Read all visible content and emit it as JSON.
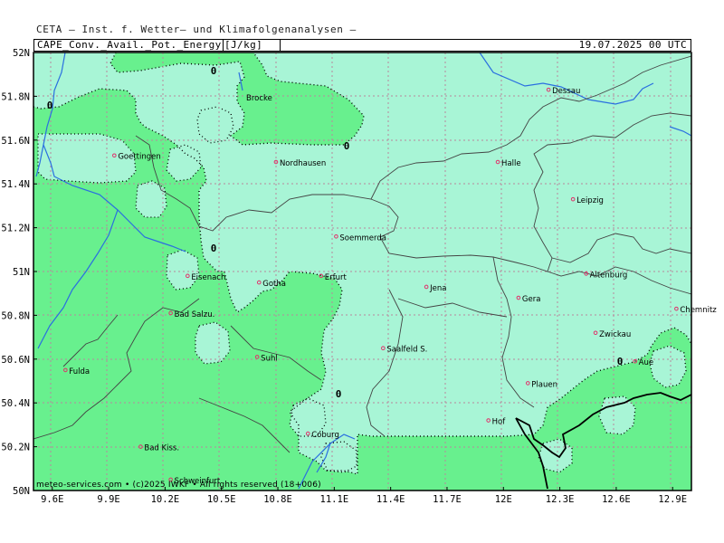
{
  "header": {
    "source": "CETA — Inst. f. Wetter— und Klimafolgenanalysen —",
    "product": "CAPE_Conv._Avail._Pot._Energy",
    "unit": "[J/kg]",
    "valid": "19.07.2025 00 UTC"
  },
  "footer": {
    "copyright": "meteo-services.com • (c)2025 IWKF • All rights reserved (18+006)"
  },
  "axes": {
    "lat_labels": [
      "52N",
      "51.8N",
      "51.6N",
      "51.4N",
      "51.2N",
      "51N",
      "50.8N",
      "50.6N",
      "50.4N",
      "50.2N",
      "50N"
    ],
    "lon_labels": [
      "9.6E",
      "9.9E",
      "10.2E",
      "10.5E",
      "10.8E",
      "11.1E",
      "11.4E",
      "11.7E",
      "12E",
      "12.3E",
      "12.6E",
      "12.9E"
    ],
    "lat_values": [
      52,
      51.8,
      51.6,
      51.4,
      51.2,
      51.0,
      50.8,
      50.6,
      50.4,
      50.2,
      50.0
    ],
    "lon_values": [
      9.6,
      9.9,
      10.2,
      10.5,
      10.8,
      11.1,
      11.4,
      11.7,
      12.0,
      12.3,
      12.6,
      12.9
    ]
  },
  "colors": {
    "cape_zero": "#a8f5d6",
    "cape_low": "#68f08e",
    "contour_label_color": "#000000",
    "city_marker": "#e0306a",
    "river": "#2a6fe0",
    "border": "#444444"
  },
  "contour_labels": [
    "0",
    "0",
    "0",
    "0",
    "0",
    "0"
  ],
  "cities": [
    {
      "name": "Goettingen",
      "lon": 9.93,
      "lat": 51.53
    },
    {
      "name": "Nordhausen",
      "lon": 10.79,
      "lat": 51.5
    },
    {
      "name": "Halle",
      "lon": 11.97,
      "lat": 51.5
    },
    {
      "name": "Dessau",
      "lon": 12.24,
      "lat": 51.83
    },
    {
      "name": "Leipzig",
      "lon": 12.37,
      "lat": 51.33
    },
    {
      "name": "Soemmerda",
      "lon": 11.11,
      "lat": 51.16
    },
    {
      "name": "Eisenach",
      "lon": 10.32,
      "lat": 50.98
    },
    {
      "name": "Gotha",
      "lon": 10.7,
      "lat": 50.95
    },
    {
      "name": "Erfurt",
      "lon": 11.03,
      "lat": 50.98
    },
    {
      "name": "Jena",
      "lon": 11.59,
      "lat": 50.93
    },
    {
      "name": "Gera",
      "lon": 12.08,
      "lat": 50.88
    },
    {
      "name": "Altenburg",
      "lon": 12.44,
      "lat": 50.99
    },
    {
      "name": "Chemnitz",
      "lon": 12.92,
      "lat": 50.83
    },
    {
      "name": "Bad Salzu.",
      "lon": 10.23,
      "lat": 50.81
    },
    {
      "name": "Saalfeld S.",
      "lon": 11.36,
      "lat": 50.65
    },
    {
      "name": "Zwickau",
      "lon": 12.49,
      "lat": 50.72
    },
    {
      "name": "Suhl",
      "lon": 10.69,
      "lat": 50.61
    },
    {
      "name": "Fulda",
      "lon": 9.67,
      "lat": 50.55
    },
    {
      "name": "Aue",
      "lon": 12.7,
      "lat": 50.59
    },
    {
      "name": "Plauen",
      "lon": 12.13,
      "lat": 50.49
    },
    {
      "name": "Hof",
      "lon": 11.92,
      "lat": 50.32
    },
    {
      "name": "Coburg",
      "lon": 10.96,
      "lat": 50.26
    },
    {
      "name": "Bad Kiss.",
      "lon": 10.07,
      "lat": 50.2
    },
    {
      "name": "Schweinfurt",
      "lon": 10.23,
      "lat": 50.05
    }
  ],
  "partial_labels": [
    "Brocke"
  ]
}
